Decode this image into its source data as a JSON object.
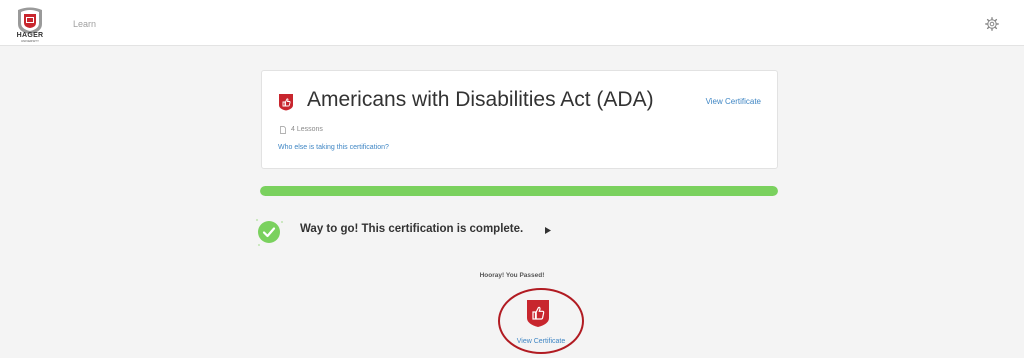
{
  "header": {
    "logo_text": "HAGER",
    "logo_subtext": "UNIVERSITY",
    "nav_learn": "Learn"
  },
  "course": {
    "title": "Americans with Disabilities Act (ADA)",
    "view_certificate": "View Certificate",
    "lessons": "4 Lessons",
    "who_else": "Who else is taking this certification?"
  },
  "progress": {
    "percent": 100
  },
  "completion": {
    "message": "Way to go! This certification is complete."
  },
  "certificate": {
    "hooray": "Hooray! You Passed!",
    "view_certificate": "View Certificate"
  },
  "colors": {
    "brand_red": "#c8262e",
    "link_blue": "#3f86c4",
    "success_green": "#7ad15e"
  },
  "icons": [
    "hager-university-logo",
    "gear-icon",
    "certificate-badge-icon",
    "document-icon",
    "check-icon",
    "triangle-right-icon"
  ]
}
